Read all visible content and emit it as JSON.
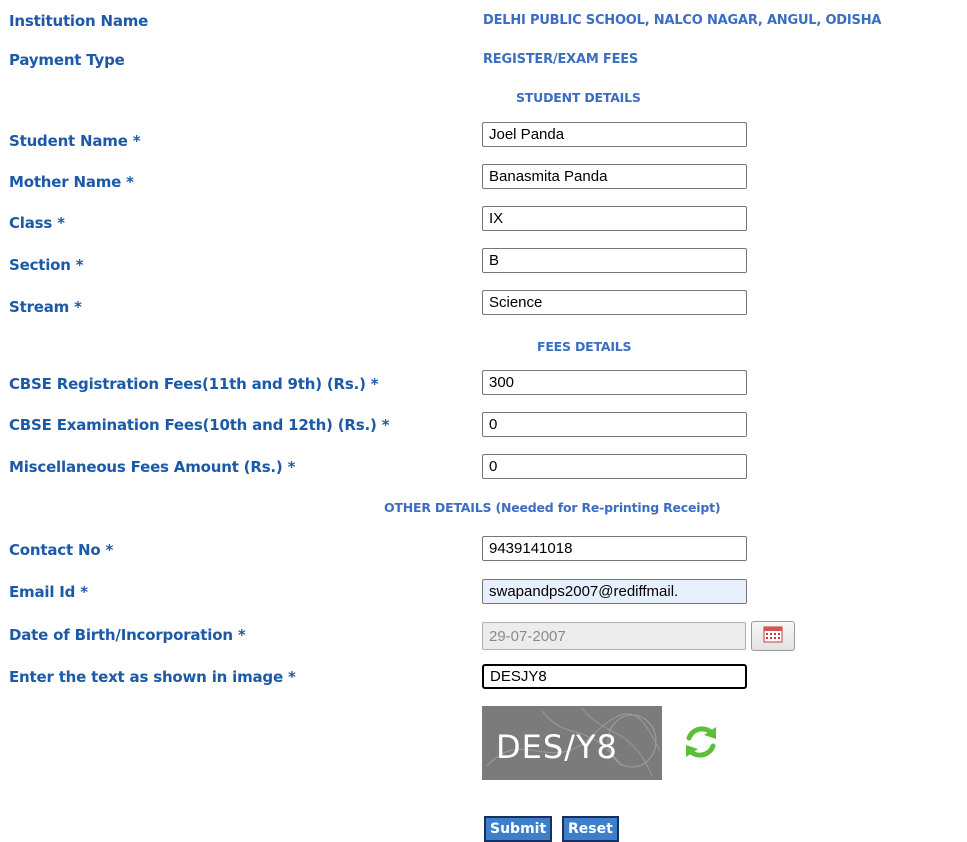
{
  "header": {
    "institution_label": "Institution Name",
    "institution_value": "DELHI PUBLIC SCHOOL, NALCO NAGAR, ANGUL, ODISHA",
    "payment_type_label": "Payment Type",
    "payment_type_value": "REGISTER/EXAM FEES"
  },
  "student": {
    "section_title": "STUDENT DETAILS",
    "student_name_label": "Student Name *",
    "student_name": "Joel Panda",
    "mother_name_label": "Mother Name *",
    "mother_name": "Banasmita Panda",
    "class_label": "Class *",
    "class": "IX",
    "section_label": "Section *",
    "section": "B",
    "stream_label": "Stream *",
    "stream": "Science"
  },
  "fees": {
    "section_title": "FEES DETAILS",
    "registration_label": "CBSE Registration Fees(11th and 9th) (Rs.) *",
    "registration": "300",
    "examination_label": "CBSE Examination Fees(10th and 12th) (Rs.) *",
    "examination": "0",
    "misc_label": "Miscellaneous Fees Amount (Rs.) *",
    "misc": "0"
  },
  "other": {
    "section_title": "OTHER DETAILS (Needed for Re-printing Receipt)",
    "contact_label": "Contact No *",
    "contact": "9439141018",
    "email_label": "Email Id *",
    "email": "swapandps2007@rediffmail.",
    "dob_label": "Date of Birth/Incorporation *",
    "dob": "29-07-2007",
    "captcha_label": "Enter the text as shown in image *",
    "captcha_input": "DESJY8",
    "captcha_image_text": "DES/Y8"
  },
  "buttons": {
    "submit": "Submit",
    "reset": "Reset"
  },
  "colors": {
    "label": "#1c5aa8",
    "info": "#3b6ec0",
    "button": "#3d7fcb",
    "refresh_icon": "#5cbf3a"
  }
}
